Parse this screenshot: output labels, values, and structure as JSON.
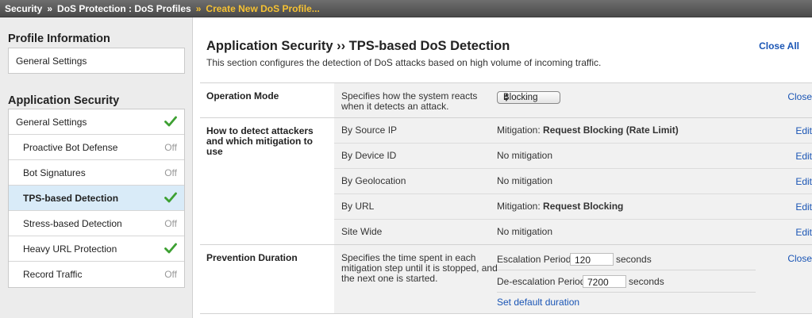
{
  "breadcrumb": {
    "items": [
      "Security",
      "DoS Protection : DoS Profiles"
    ],
    "separator": "»",
    "current": "Create New DoS Profile..."
  },
  "sidebar": {
    "profile_heading": "Profile Information",
    "profile_item": "General Settings",
    "app_heading": "Application Security",
    "items": [
      {
        "label": "General Settings",
        "status": "check"
      },
      {
        "label": "Proactive Bot Defense",
        "status": "Off"
      },
      {
        "label": "Bot Signatures",
        "status": "Off"
      },
      {
        "label": "TPS-based Detection",
        "status": "check",
        "active": true
      },
      {
        "label": "Stress-based Detection",
        "status": "Off"
      },
      {
        "label": "Heavy URL Protection",
        "status": "check"
      },
      {
        "label": "Record Traffic",
        "status": "Off"
      }
    ]
  },
  "main": {
    "title": "Application Security ›› TPS-based DoS Detection",
    "description": "This section configures the detection of DoS attacks based on high volume of incoming traffic.",
    "close_all": "Close All",
    "operation_mode": {
      "label": "Operation Mode",
      "desc_line1": "Specifies how the system reacts",
      "desc_line2": "when it detects an attack.",
      "select_value": "Blocking",
      "close": "Close"
    },
    "detect": {
      "label_line1": "How to detect attackers",
      "label_line2": "and which mitigation to",
      "label_line3": "use",
      "edit": "Edit",
      "rows": [
        {
          "name": "By Source IP",
          "prefix": "Mitigation: ",
          "value": "Request Blocking (Rate Limit)"
        },
        {
          "name": "By Device ID",
          "prefix": "",
          "value": "No mitigation"
        },
        {
          "name": "By Geolocation",
          "prefix": "",
          "value": "No mitigation"
        },
        {
          "name": "By URL",
          "prefix": "Mitigation: ",
          "value": "Request Blocking"
        },
        {
          "name": "Site Wide",
          "prefix": "",
          "value": "No mitigation"
        }
      ]
    },
    "prevention": {
      "label": "Prevention Duration",
      "desc_line1": "Specifies the time spent in each",
      "desc_line2": "mitigation step until it is stopped, and",
      "desc_line3": "the next one is started.",
      "escalation_label": "Escalation Period:",
      "escalation_value": "120",
      "deescalation_label": "De-escalation Period:",
      "deescalation_value": "7200",
      "unit": "seconds",
      "default_link": "Set default duration",
      "close": "Close"
    }
  },
  "colors": {
    "link": "#1a55b5",
    "current_crumb": "#f6c233",
    "active_item_bg": "#d9ebf8",
    "check": "#3da032"
  }
}
